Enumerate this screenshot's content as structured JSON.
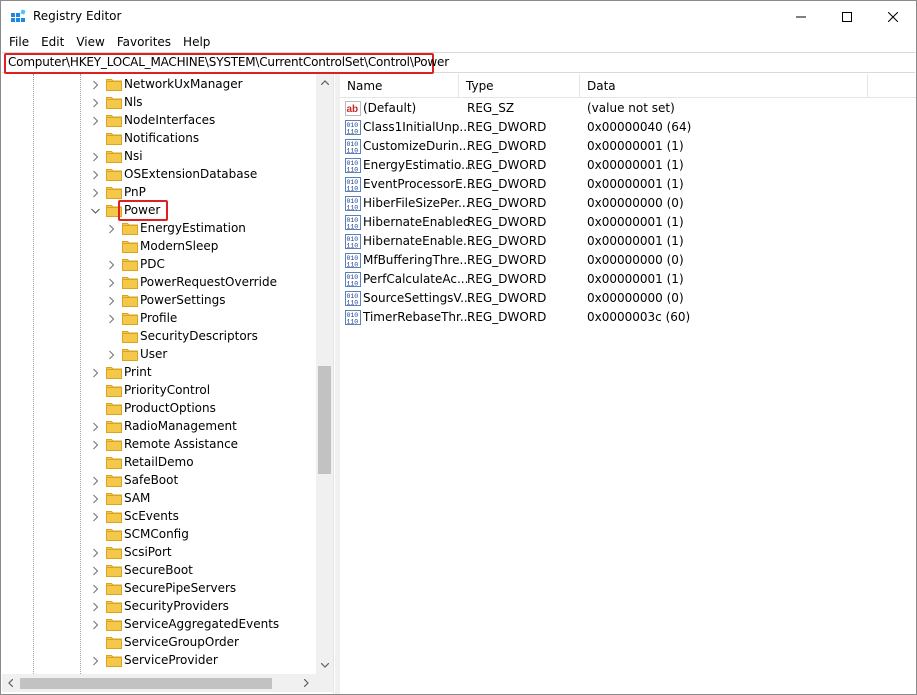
{
  "window": {
    "title": "Registry Editor"
  },
  "menu": [
    "File",
    "Edit",
    "View",
    "Favorites",
    "Help"
  ],
  "address": {
    "path": "Computer\\HKEY_LOCAL_MACHINE\\SYSTEM\\CurrentControlSet\\Control\\Power"
  },
  "tree": {
    "items": [
      {
        "label": "NetworkUxManager",
        "level": 1,
        "expander": "collapsed"
      },
      {
        "label": "Nls",
        "level": 1,
        "expander": "collapsed"
      },
      {
        "label": "NodeInterfaces",
        "level": 1,
        "expander": "collapsed"
      },
      {
        "label": "Notifications",
        "level": 1,
        "expander": "none"
      },
      {
        "label": "Nsi",
        "level": 1,
        "expander": "collapsed"
      },
      {
        "label": "OSExtensionDatabase",
        "level": 1,
        "expander": "collapsed"
      },
      {
        "label": "PnP",
        "level": 1,
        "expander": "collapsed"
      },
      {
        "label": "Power",
        "level": 1,
        "expander": "expanded",
        "selected": true
      },
      {
        "label": "EnergyEstimation",
        "level": 2,
        "expander": "collapsed"
      },
      {
        "label": "ModernSleep",
        "level": 2,
        "expander": "none"
      },
      {
        "label": "PDC",
        "level": 2,
        "expander": "collapsed"
      },
      {
        "label": "PowerRequestOverride",
        "level": 2,
        "expander": "collapsed"
      },
      {
        "label": "PowerSettings",
        "level": 2,
        "expander": "collapsed"
      },
      {
        "label": "Profile",
        "level": 2,
        "expander": "collapsed"
      },
      {
        "label": "SecurityDescriptors",
        "level": 2,
        "expander": "none"
      },
      {
        "label": "User",
        "level": 2,
        "expander": "collapsed"
      },
      {
        "label": "Print",
        "level": 1,
        "expander": "collapsed"
      },
      {
        "label": "PriorityControl",
        "level": 1,
        "expander": "none"
      },
      {
        "label": "ProductOptions",
        "level": 1,
        "expander": "none"
      },
      {
        "label": "RadioManagement",
        "level": 1,
        "expander": "collapsed"
      },
      {
        "label": "Remote Assistance",
        "level": 1,
        "expander": "collapsed"
      },
      {
        "label": "RetailDemo",
        "level": 1,
        "expander": "none"
      },
      {
        "label": "SafeBoot",
        "level": 1,
        "expander": "collapsed"
      },
      {
        "label": "SAM",
        "level": 1,
        "expander": "collapsed"
      },
      {
        "label": "ScEvents",
        "level": 1,
        "expander": "collapsed"
      },
      {
        "label": "SCMConfig",
        "level": 1,
        "expander": "none"
      },
      {
        "label": "ScsiPort",
        "level": 1,
        "expander": "collapsed"
      },
      {
        "label": "SecureBoot",
        "level": 1,
        "expander": "collapsed"
      },
      {
        "label": "SecurePipeServers",
        "level": 1,
        "expander": "collapsed"
      },
      {
        "label": "SecurityProviders",
        "level": 1,
        "expander": "collapsed"
      },
      {
        "label": "ServiceAggregatedEvents",
        "level": 1,
        "expander": "collapsed"
      },
      {
        "label": "ServiceGroupOrder",
        "level": 1,
        "expander": "none"
      },
      {
        "label": "ServiceProvider",
        "level": 1,
        "expander": "collapsed"
      }
    ]
  },
  "list": {
    "columns": [
      "Name",
      "Type",
      "Data"
    ],
    "rows": [
      {
        "icon": "string-value-icon",
        "name": "(Default)",
        "type": "REG_SZ",
        "data": "(value not set)"
      },
      {
        "icon": "binary-value-icon",
        "name": "Class1InitialUnp...",
        "type": "REG_DWORD",
        "data": "0x00000040 (64)"
      },
      {
        "icon": "binary-value-icon",
        "name": "CustomizeDurin...",
        "type": "REG_DWORD",
        "data": "0x00000001 (1)"
      },
      {
        "icon": "binary-value-icon",
        "name": "EnergyEstimatio...",
        "type": "REG_DWORD",
        "data": "0x00000001 (1)"
      },
      {
        "icon": "binary-value-icon",
        "name": "EventProcessorE...",
        "type": "REG_DWORD",
        "data": "0x00000001 (1)"
      },
      {
        "icon": "binary-value-icon",
        "name": "HiberFileSizePer...",
        "type": "REG_DWORD",
        "data": "0x00000000 (0)"
      },
      {
        "icon": "binary-value-icon",
        "name": "HibernateEnabled",
        "type": "REG_DWORD",
        "data": "0x00000001 (1)"
      },
      {
        "icon": "binary-value-icon",
        "name": "HibernateEnable...",
        "type": "REG_DWORD",
        "data": "0x00000001 (1)"
      },
      {
        "icon": "binary-value-icon",
        "name": "MfBufferingThre...",
        "type": "REG_DWORD",
        "data": "0x00000000 (0)"
      },
      {
        "icon": "binary-value-icon",
        "name": "PerfCalculateAc...",
        "type": "REG_DWORD",
        "data": "0x00000001 (1)"
      },
      {
        "icon": "binary-value-icon",
        "name": "SourceSettingsV...",
        "type": "REG_DWORD",
        "data": "0x00000000 (0)"
      },
      {
        "icon": "binary-value-icon",
        "name": "TimerRebaseThr...",
        "type": "REG_DWORD",
        "data": "0x0000003c (60)"
      }
    ]
  },
  "colors": {
    "highlight": "#e02020",
    "folder": "#f4c84a",
    "folder_edge": "#d9a520"
  }
}
